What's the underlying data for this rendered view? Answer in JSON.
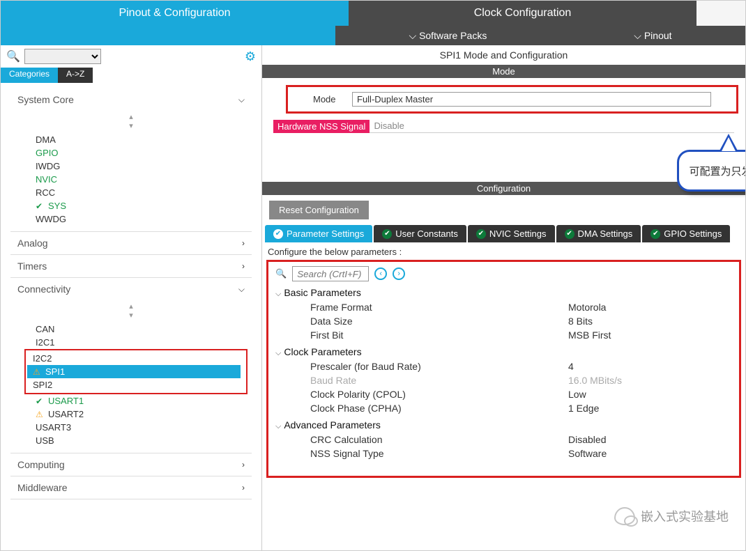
{
  "top_tabs": {
    "pinout": "Pinout & Configuration",
    "clock": "Clock Configuration"
  },
  "sub_header": {
    "software_packs": "Software Packs",
    "pinout": "Pinout"
  },
  "search": {
    "placeholder": ""
  },
  "sidebar_tabs": {
    "categories": "Categories",
    "az": "A->Z"
  },
  "categories": {
    "system_core": {
      "label": "System Core",
      "items": [
        "DMA",
        "GPIO",
        "IWDG",
        "NVIC",
        "RCC",
        "SYS",
        "WWDG"
      ]
    },
    "analog": {
      "label": "Analog"
    },
    "timers": {
      "label": "Timers"
    },
    "connectivity": {
      "label": "Connectivity",
      "items": [
        "CAN",
        "I2C1",
        "I2C2",
        "SPI1",
        "SPI2",
        "USART1",
        "USART2",
        "USART3",
        "USB"
      ]
    },
    "computing": {
      "label": "Computing"
    },
    "middleware": {
      "label": "Middleware"
    }
  },
  "panel": {
    "title": "SPI1 Mode and Configuration",
    "mode_header": "Mode",
    "mode_label": "Mode",
    "mode_value": "Full-Duplex Master",
    "nss_label": "Hardware NSS Signal",
    "nss_value": "Disable",
    "config_header": "Configuration",
    "reset_btn": "Reset Configuration",
    "callout": "可配置为只发送模式"
  },
  "config_tabs": {
    "param": "Parameter Settings",
    "user": "User Constants",
    "nvic": "NVIC Settings",
    "dma": "DMA Settings",
    "gpio": "GPIO Settings"
  },
  "params": {
    "intro": "Configure the below parameters :",
    "search_placeholder": "Search (CrtI+F)",
    "groups": [
      {
        "title": "Basic Parameters",
        "rows": [
          {
            "name": "Frame Format",
            "val": "Motorola"
          },
          {
            "name": "Data Size",
            "val": "8 Bits"
          },
          {
            "name": "First Bit",
            "val": "MSB First"
          }
        ]
      },
      {
        "title": "Clock Parameters",
        "rows": [
          {
            "name": "Prescaler (for Baud Rate)",
            "val": "4"
          },
          {
            "name": "Baud Rate",
            "val": "16.0 MBits/s",
            "dim": true
          },
          {
            "name": "Clock Polarity (CPOL)",
            "val": "Low"
          },
          {
            "name": "Clock Phase (CPHA)",
            "val": "1 Edge"
          }
        ]
      },
      {
        "title": "Advanced Parameters",
        "rows": [
          {
            "name": "CRC Calculation",
            "val": "Disabled"
          },
          {
            "name": "NSS Signal Type",
            "val": "Software"
          }
        ]
      }
    ]
  },
  "watermark": "嵌入式实验基地"
}
